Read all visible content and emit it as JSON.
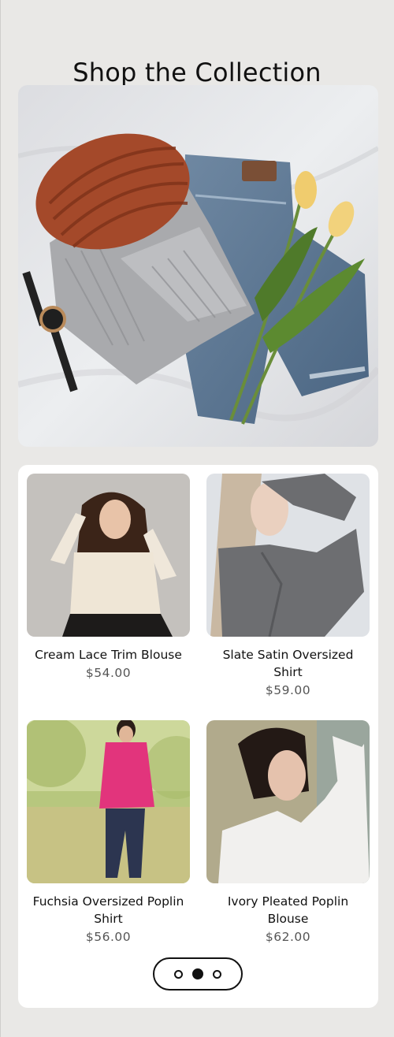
{
  "page": {
    "title": "Shop the Collection"
  },
  "products": [
    {
      "name": "Cream Lace Trim Blouse",
      "price": "$54.00"
    },
    {
      "name": "Slate Satin Oversized Shirt",
      "price": "$59.00"
    },
    {
      "name": "Fuchsia Oversized Poplin Shirt",
      "price": "$56.00"
    },
    {
      "name": "Ivory Pleated Poplin Blouse",
      "price": "$62.00"
    }
  ],
  "pager": {
    "pages": 3,
    "active_index": 1
  },
  "colors": {
    "background": "#e9e8e6",
    "card": "#ffffff",
    "text": "#111111",
    "price": "#555555"
  }
}
